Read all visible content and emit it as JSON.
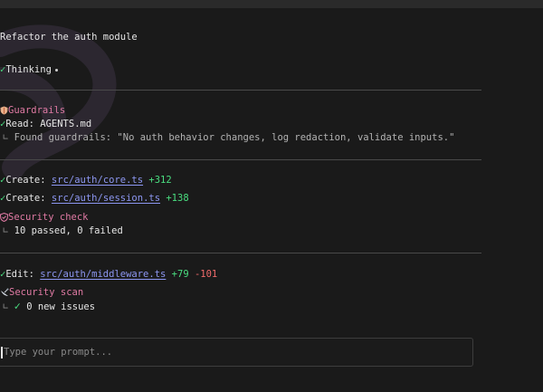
{
  "user_message": "Refactor the auth module",
  "thinking": {
    "label": "Thinking"
  },
  "guardrails": {
    "title": "Guardrails",
    "read_label": "Read:",
    "read_file": "AGENTS.md",
    "found_text": "Found guardrails: \"No auth behavior changes, log redaction, validate inputs.\""
  },
  "creates": [
    {
      "action": "Create:",
      "file": "src/auth/core.ts",
      "added": "+312"
    },
    {
      "action": "Create:",
      "file": "src/auth/session.ts",
      "added": "+138"
    }
  ],
  "security_check": {
    "title": "Security check",
    "result": "10 passed, 0 failed"
  },
  "edit": {
    "action": "Edit:",
    "file": "src/auth/middleware.ts",
    "added": "+79",
    "removed": "-101"
  },
  "security_scan": {
    "title": "Security scan",
    "result": "0 new issues"
  },
  "prompt": {
    "placeholder": "Type your prompt..."
  },
  "icons": {
    "check": "check-icon",
    "guardrails": "shield-icon",
    "security_check": "shield-check-icon",
    "security_scan": "satellite-dish-icon",
    "tree_branch": "tree-branch-icon"
  },
  "colors": {
    "background": "#1a1a1a",
    "check": "#4ade80",
    "section_title": "#e07aa4",
    "link": "#8d97f2",
    "added": "#4ade80",
    "removed": "#f06b6b"
  }
}
